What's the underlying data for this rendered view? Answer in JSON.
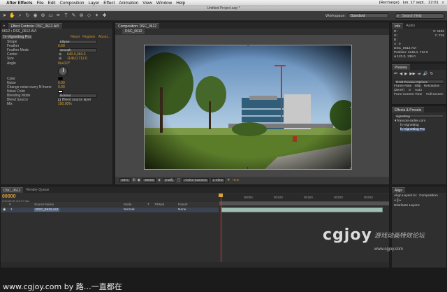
{
  "menubar": {
    "app": "After Effects",
    "items": [
      "File",
      "Edit",
      "Composition",
      "Layer",
      "Effect",
      "Animation",
      "View",
      "Window",
      "Help"
    ],
    "status": [
      "(Recharge)",
      "lun. 17 sept.",
      "22:01"
    ]
  },
  "document_title": "Untitled Project.aep *",
  "toolbar": {
    "workspace_label": "Workspace:",
    "workspace_value": "Standard",
    "search_placeholder": "Search Help"
  },
  "effect_controls": {
    "tab": "Effect Controls: DSC_0612.AVI",
    "header": "0612 • DSC_0612.AVI",
    "effect_name": "fx-Vignetting Pro",
    "links": [
      "Reset",
      "Register",
      "About..."
    ],
    "rows": [
      {
        "label": "Shape",
        "kind": "dropdown",
        "value": "Ellipse"
      },
      {
        "label": "Feather",
        "kind": "value",
        "value": "0.60"
      },
      {
        "label": "Feather Mode",
        "kind": "dropdown",
        "value": "Smooth"
      },
      {
        "label": "Center",
        "kind": "point",
        "value": "640.0,360.0"
      },
      {
        "label": "Size",
        "kind": "point",
        "value": "1146.0,712.0"
      },
      {
        "label": "Angle",
        "kind": "value",
        "value": "0x+0.0°"
      }
    ],
    "rows2": [
      {
        "label": "Color",
        "kind": "swatch",
        "color": "#000000"
      },
      {
        "label": "Noise",
        "kind": "value",
        "value": "0.00"
      },
      {
        "label": "Change noise every N frame",
        "kind": "value",
        "value": "0.00"
      },
      {
        "label": "Noise Color",
        "kind": "swatch",
        "color": "#ffffff"
      },
      {
        "label": "Blending Mode",
        "kind": "dropdown",
        "value": "Normal"
      },
      {
        "label": "Blend Source",
        "kind": "checkbox",
        "value": "Blend source layer"
      },
      {
        "label": "Mix",
        "kind": "value",
        "value": "100.00%"
      }
    ]
  },
  "composition": {
    "tab": "Composition: DSC_0612",
    "subtab": "DSC_0612",
    "viewer_bar": [
      "50%",
      "00000",
      "(Half)",
      "Active Camera",
      "1 View",
      "+0.0"
    ]
  },
  "info": {
    "tabs": [
      "Info",
      "Audio"
    ],
    "lines": [
      "R :",
      "G :",
      "B :",
      "A : 0",
      "DSC_0612.AVI",
      "Position: 1146.0, 712.0",
      "Δ 122.0, 136.0"
    ],
    "coords": [
      "X: 1156",
      "Y: 716"
    ]
  },
  "preview": {
    "tab": "Preview",
    "controls": [
      "⏮",
      "◀",
      "▶",
      "▶▶",
      "⏭",
      "🔊",
      "↻"
    ],
    "mode": "RAM Preview Options",
    "labels": [
      "Frame Rate",
      "Skip",
      "Resolution"
    ],
    "values": [
      "(29.97)",
      "0",
      "Auto"
    ],
    "options": [
      "From Current Time",
      "Full Screen"
    ]
  },
  "effects_presets": {
    "tab": "Effects & Presets",
    "search": "vignetting",
    "tree": [
      "▾ francois-tarlier.com",
      "fx-Vignetting",
      "fx-Vignetting Pro"
    ]
  },
  "timeline": {
    "tabs": [
      "DSC_0612",
      "Render Queue"
    ],
    "time": "00000",
    "timesub": "0:00:00:00 (29.97 fps)",
    "columns": [
      "#",
      "Source Name",
      "Mode",
      "T",
      "TrkMat",
      "Parent"
    ],
    "layer": {
      "index": "1",
      "name": "DSC_0612.AVI",
      "mode": "Normal",
      "parent": "None"
    },
    "ruler": [
      "00050",
      "00100",
      "00150",
      "00200",
      "00250"
    ]
  },
  "align": {
    "tab": "Align",
    "lines": [
      "Align Layers to:",
      "Composition",
      "Distribute Layers:"
    ]
  },
  "footer": {
    "credit": "www.cgjoy.com by 路…一直都在",
    "logo": "cgjoy",
    "logo_cn": "游戏动画特效论坛",
    "logo_url": "www.cgjoy.com"
  },
  "colors": {
    "accent": "#d9a23a",
    "cti": "#dd3333",
    "layer_bar": "#9ebfb4"
  }
}
